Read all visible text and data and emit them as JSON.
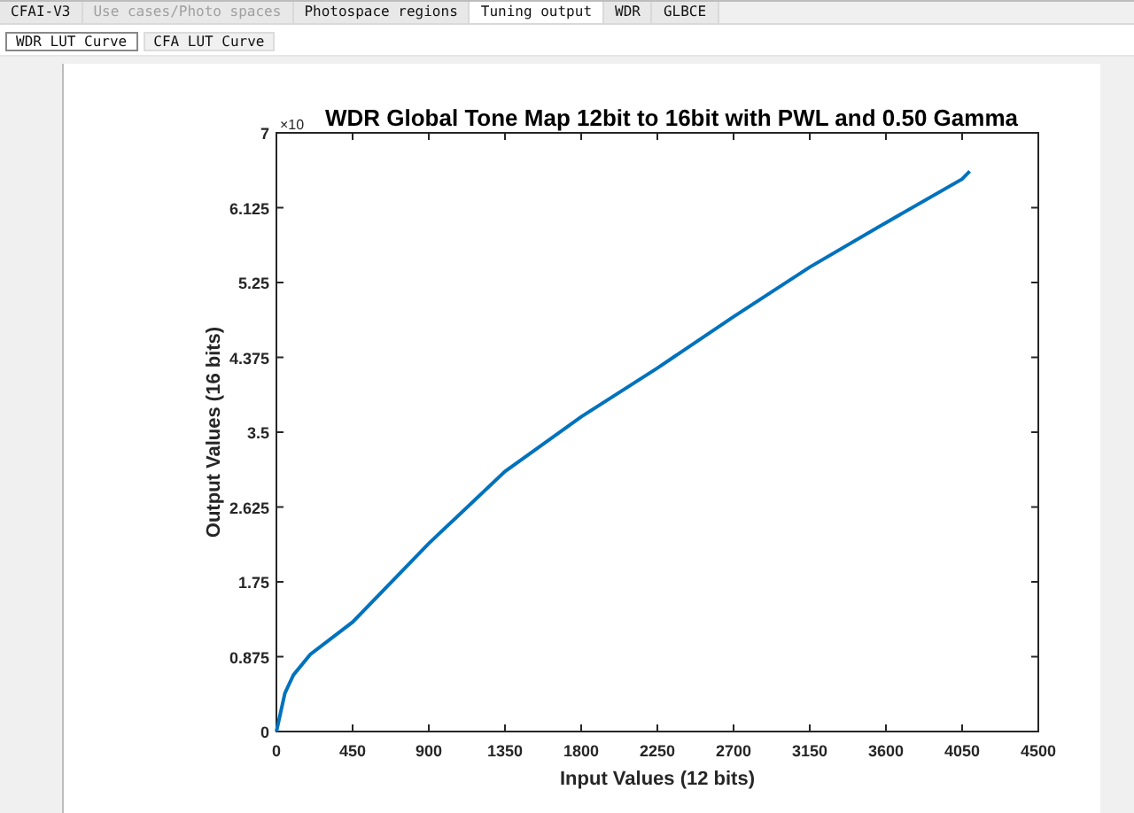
{
  "tabs": [
    {
      "label": "CFAI-V3",
      "selected": false,
      "disabled": false
    },
    {
      "label": "Use cases/Photo spaces",
      "selected": false,
      "disabled": true
    },
    {
      "label": "Photospace regions",
      "selected": false,
      "disabled": false
    },
    {
      "label": "Tuning output",
      "selected": true,
      "disabled": false
    },
    {
      "label": "WDR",
      "selected": false,
      "disabled": false
    },
    {
      "label": "GLBCE",
      "selected": false,
      "disabled": false
    }
  ],
  "subtabs": [
    {
      "label": "WDR LUT Curve",
      "selected": true
    },
    {
      "label": "CFA LUT Curve",
      "selected": false
    }
  ],
  "figure": {
    "exponent_label": "×10",
    "chart_data": {
      "type": "line",
      "title": "WDR Global Tone Map 12bit to 16bit with PWL and 0.50 Gamma",
      "xlabel": "Input Values (12 bits)",
      "ylabel": "Output Values (16 bits)",
      "x": [
        0,
        50,
        100,
        200,
        450,
        900,
        1350,
        1800,
        2250,
        2700,
        3150,
        3600,
        4050,
        4095
      ],
      "series": [
        {
          "color": "#0072bd",
          "values": [
            0,
            0.45,
            0.66,
            0.9,
            1.28,
            2.2,
            3.04,
            3.68,
            4.25,
            4.85,
            5.43,
            5.95,
            6.46,
            6.55
          ]
        }
      ],
      "xlim": [
        0,
        4500
      ],
      "ylim": [
        0,
        7
      ],
      "xticks": [
        0,
        450,
        900,
        1350,
        1800,
        2250,
        2700,
        3150,
        3600,
        4050,
        4500
      ],
      "yticks": [
        {
          "value": 0,
          "label": "0"
        },
        {
          "value": 0.875,
          "label": "0.875"
        },
        {
          "value": 1.75,
          "label": "1.75"
        },
        {
          "value": 2.625,
          "label": "2.625"
        },
        {
          "value": 3.5,
          "label": "3.5"
        },
        {
          "value": 4.375,
          "label": "4.375"
        },
        {
          "value": 5.25,
          "label": "5.25"
        },
        {
          "value": 6.125,
          "label": "6.125"
        },
        {
          "value": 7,
          "label": "7"
        }
      ]
    }
  }
}
